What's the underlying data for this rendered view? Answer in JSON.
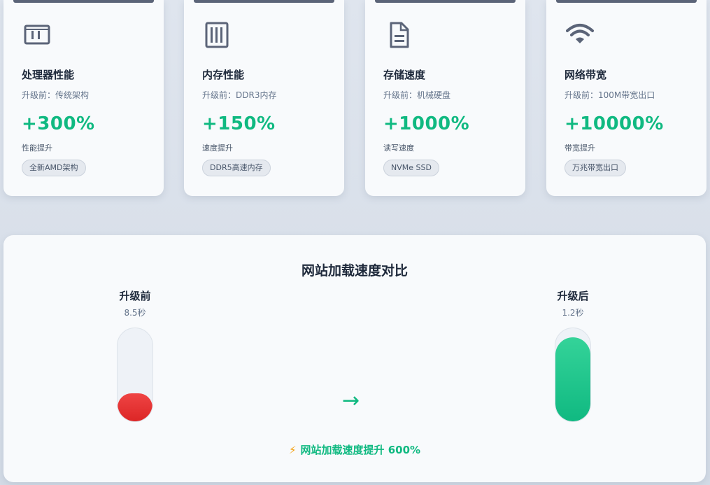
{
  "cards": [
    {
      "icon": "cpu-icon",
      "title": "处理器性能",
      "before": "升级前：传统架构",
      "value": "+300%",
      "metric": "性能提升",
      "badge": "全新AMD架构"
    },
    {
      "icon": "memory-icon",
      "title": "内存性能",
      "before": "升级前：DDR3内存",
      "value": "+150%",
      "metric": "速度提升",
      "badge": "DDR5高速内存"
    },
    {
      "icon": "document-icon",
      "title": "存储速度",
      "before": "升级前：机械硬盘",
      "value": "+1000%",
      "metric": "读写速度",
      "badge": "NVMe SSD"
    },
    {
      "icon": "wifi-icon",
      "title": "网络带宽",
      "before": "升级前：100M带宽出口",
      "value": "+10000%",
      "metric": "带宽提升",
      "badge": "万兆带宽出口"
    }
  ],
  "compare": {
    "title": "网站加载速度对比",
    "before": {
      "label": "升级前",
      "time": "8.5秒",
      "fill_fraction": 0.3
    },
    "after": {
      "label": "升级后",
      "time": "1.2秒",
      "fill_fraction": 0.9
    },
    "arrow": "→",
    "summary_icon": "⚡",
    "summary": "网站加载速度提升 600%"
  },
  "colors": {
    "accent": "#10b981",
    "danger": "#ef4444",
    "text": "#1e293b",
    "muted": "#64748b"
  }
}
